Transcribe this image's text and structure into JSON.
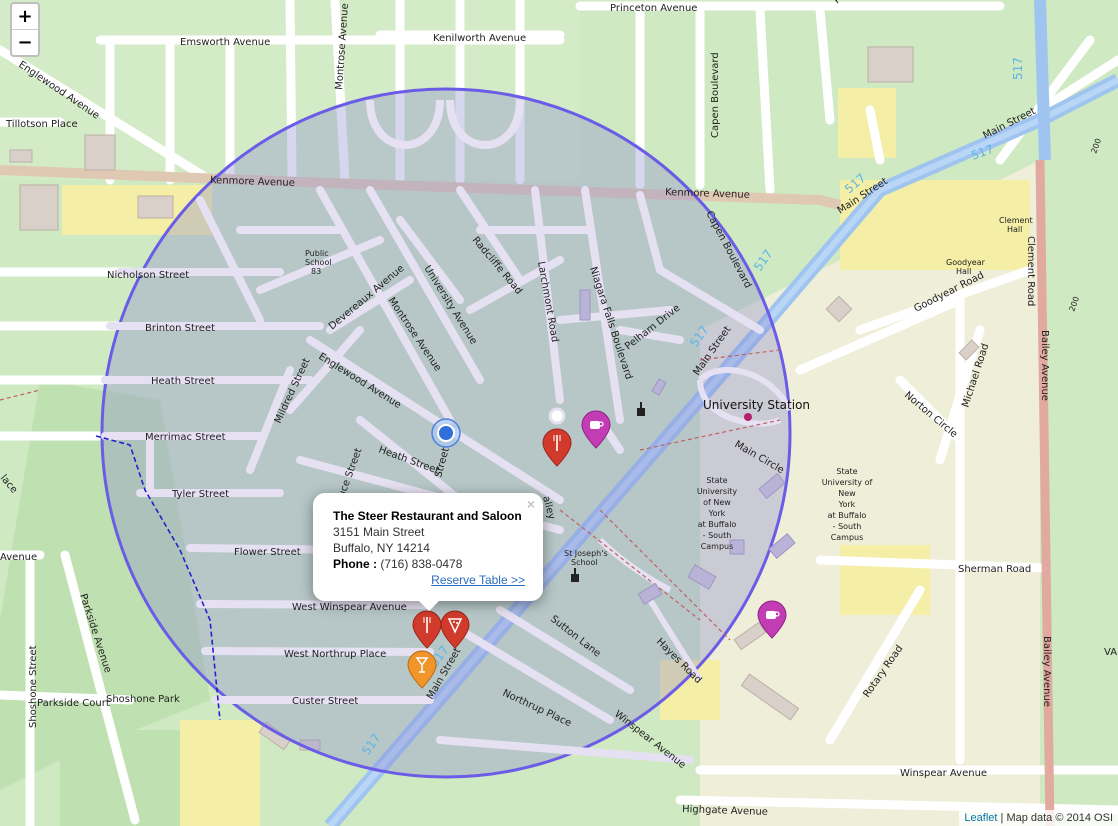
{
  "zoom": {
    "in_label": "+",
    "out_label": "−"
  },
  "popup": {
    "close": "×",
    "name": "The Steer Restaurant and Saloon",
    "address1": "3151 Main Street",
    "address2": "Buffalo, NY 14214",
    "phone_label": "Phone :",
    "phone": " (716) 838-0478",
    "link": "Reserve Table >>"
  },
  "attribution": {
    "leaflet": "Leaflet",
    "sep": " | ",
    "text": "Map data © 2014 OSI"
  },
  "labels": {
    "princeton": "Princeton Avenue",
    "emsworth": "Emsworth Avenue",
    "kenilworth": "Kenilworth Avenue",
    "englewood_top": "Englewood Avenue",
    "tillotson": "Tillotson Place",
    "montrose_top": "Montrose Avenue",
    "kenmore1": "Kenmore Avenue",
    "kenmore2": "Kenmore Avenue",
    "capen_top": "Capen Boulevard",
    "capen": "Capen Boulevard",
    "main_ne": "Main Street",
    "main_ne2": "Main Street",
    "main_mid": "Main Street",
    "main_sw": "Main Street",
    "nicholson": "Nicholson Street",
    "brinton": "Brinton Street",
    "heath": "Heath Street",
    "heath2": "Heath Street",
    "merrimac": "Merrimac Street",
    "tyler": "Tyler Street",
    "flower": "Flower Street",
    "west_winspear": "West Winspear Avenue",
    "west_northrup": "West Northrup Place",
    "custer": "Custer Street",
    "parkside_court": "Parkside Court",
    "shoshone_park": "Shoshone Park",
    "shoshone_street": "Shoshone Street",
    "parkside_ave": "Parkside Avenue",
    "avenue_left": "Avenue",
    "lace": "lace",
    "devereaux": "Devereaux Avenue",
    "montrose": "Montrose Avenue",
    "englewood": "Englewood Avenue",
    "mildred": "Mildred Street",
    "university_ave": "University Avenue",
    "radcliffe": "Radcliffe Road",
    "larchmont": "Larchmont Road",
    "niagara_falls": "Niagara Falls Boulevard",
    "pelham": "Pelham Drive",
    "public_school1": "Public",
    "public_school2": "School",
    "public_school3": "83",
    "university_station": "University Station",
    "main_circle": "Main Circle",
    "suny": [
      "State",
      "University",
      "of New",
      "York",
      "at Buffalo",
      "- South",
      "Campus"
    ],
    "suny2": [
      "State",
      "University of",
      "New",
      "York",
      "at Buffalo",
      "- South",
      "Campus"
    ],
    "st_josephs1": "St Joseph's",
    "st_josephs2": "School",
    "sutton": "Sutton Lane",
    "hayes": "Hayes Road",
    "northrup": "Northrup Place",
    "winspear_ave_diag": "Winspear Avenue",
    "winspear_ave": "Winspear Avenue",
    "highgate": "Highgate Avenue",
    "sherman": "Sherman Road",
    "rotary": "Rotary Road",
    "norton": "Norton Circle",
    "michael": "Michael Road",
    "goodyear_rd": "Goodyear Road",
    "goodyear_hall1": "Goodyear",
    "goodyear_hall2": "Hall",
    "clement_hall1": "Clement",
    "clement_hall2": "Hall",
    "clement_road": "Clement Road",
    "bailey1": "Bailey Avenue",
    "bailey2": "Bailey Avenue",
    "bruce": "uce Street",
    "heath_st_frag": "Street",
    "valley": "alley",
    "va": "VA",
    "pr": "Pr",
    "route1": "517",
    "route2": "517",
    "route3": "517",
    "route4": "517",
    "route5": "517",
    "route6": "517",
    "route7": "517",
    "elev1": "200",
    "elev2": "200"
  },
  "markers": [
    {
      "type": "restaurant",
      "color": "#d13b2b",
      "icon": "fork-knife"
    },
    {
      "type": "restaurant",
      "color": "#d13b2b",
      "icon": "fork-knife"
    },
    {
      "type": "pizza",
      "color": "#d13b2b",
      "icon": "pizza"
    },
    {
      "type": "bar",
      "color": "#f0952a",
      "icon": "wine-glass"
    },
    {
      "type": "cafe",
      "color": "#c23cb4",
      "icon": "coffee-cup"
    },
    {
      "type": "cafe",
      "color": "#c23cb4",
      "icon": "coffee-cup"
    }
  ],
  "colors": {
    "circle": "#6b5ce7",
    "circle_fill": "#8a8ad0",
    "main_street": "#9fc4f0"
  }
}
